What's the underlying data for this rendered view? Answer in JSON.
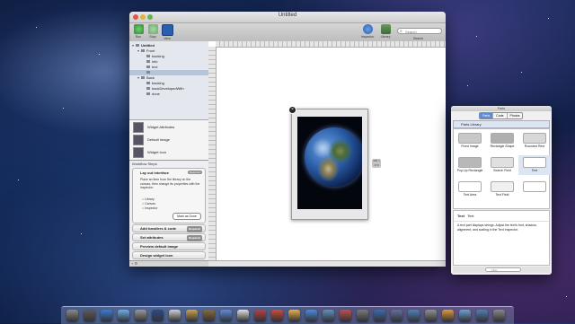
{
  "window": {
    "title": "Untitled"
  },
  "toolbar": {
    "run_label": "Run",
    "stop_label": "Stop",
    "view_label": "View",
    "inspector_label": "Inspector",
    "library_label": "Library",
    "search_placeholder": "Search",
    "search_label": "Search"
  },
  "sidebar": {
    "tree": [
      {
        "label": "Untitled",
        "indent": 0,
        "expanded": true
      },
      {
        "label": "Front",
        "indent": 1,
        "expanded": true
      },
      {
        "label": "backing",
        "indent": 2
      },
      {
        "label": "info",
        "indent": 2
      },
      {
        "label": "text",
        "indent": 2
      },
      {
        "label": "",
        "indent": 2,
        "selected": true
      },
      {
        "label": "Back",
        "indent": 1,
        "expanded": true
      },
      {
        "label": "backing",
        "indent": 2
      },
      {
        "label": "backDevelopedWith",
        "indent": 2
      },
      {
        "label": "done",
        "indent": 2
      }
    ],
    "assets": [
      {
        "label": "Widget Attributes"
      },
      {
        "label": "Default Image"
      },
      {
        "label": "Widget Icon"
      }
    ]
  },
  "steps": {
    "header": "Workflow Steps",
    "active": {
      "title": "Lay out interface",
      "badge": "Required",
      "description": "Place an item from the library on the canvas, then change its properties with the inspector.",
      "checklist": [
        "Library",
        "Canvas",
        "Inspector"
      ],
      "mark_done": "Mark as Done"
    },
    "rows": [
      {
        "label": "Add handlers & code",
        "badge": "Required"
      },
      {
        "label": "Set attributes",
        "badge": "Required"
      },
      {
        "label": "Preview default image",
        "badge": ""
      },
      {
        "label": "Design widget icon",
        "badge": ""
      },
      {
        "label": "Test & share",
        "badge": ""
      }
    ],
    "bottom": "+  ⚙"
  },
  "canvas": {
    "close_glyph": "×",
    "size_tag": "300 × 470"
  },
  "parts": {
    "window_title": "Parts",
    "tabs": [
      "Parts",
      "Code",
      "Photos"
    ],
    "active_tab": "Parts",
    "category": "Parts Library",
    "items": [
      {
        "label": "Fixed Image",
        "color": "#c8c8c8"
      },
      {
        "label": "Rectangle Shape",
        "color": "#b0b0b0"
      },
      {
        "label": "Rounded Rect",
        "color": "#d8d8d8"
      },
      {
        "label": "Pop-Up Rectangle",
        "color": "#b8b8b8"
      },
      {
        "label": "Search Field",
        "color": "#e0e0e0"
      },
      {
        "label": "Text",
        "color": "#ffffff",
        "selected": true
      },
      {
        "label": "Text Area",
        "color": "#ffffff"
      },
      {
        "label": "Text Field",
        "color": "#f0f0f0"
      },
      {
        "label": "",
        "color": "#ffffff"
      }
    ],
    "info_title": "Text",
    "info_title2": "Text",
    "info_desc": "A text part displays strings. Adjust the text's font, shadow, alignment, and scaling in the Text Inspector.",
    "bottom_search": "Filter"
  },
  "dock": {
    "colors": [
      "#8a8a8a",
      "#5a5a5a",
      "#3b7bd6",
      "#6ab0f0",
      "#9a9a9a",
      "#2b4a8a",
      "#d0d0d0",
      "#c9a24a",
      "#8a6a3a",
      "#5b8de0",
      "#e0e0e0",
      "#b84040",
      "#d04a3a",
      "#e8b04a",
      "#4a8ae0",
      "#6090c0",
      "#c05050",
      "#7a7a7a",
      "#3a6ab0",
      "#6070a0",
      "#5080c0",
      "#909090",
      "#e09a40",
      "#6aa0d8",
      "#4f7fb8",
      "#888888"
    ]
  }
}
